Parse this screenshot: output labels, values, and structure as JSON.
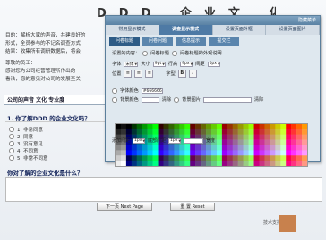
{
  "survey": {
    "title": "DDD 企业文 化 调查",
    "intro": [
      "目的：解析大家的声音，共建良好的",
      "形式，全员参与的不记名调查方式",
      "结果：收集所有调研数据后，将会"
    ],
    "greeting": [
      "尊敬的员工：",
      "感谢您为公司经营管理所作出的",
      "看法，您的意见对公司的发展至关"
    ],
    "section": "公司的声音 文化 专业度",
    "q1": "1. 你了解DDD 的企业文化吗？",
    "options": [
      "1. 非常同意",
      "2. 同意",
      "3. 没有意见",
      "4. 不同意",
      "5. 非常不同意"
    ],
    "q2": "你对了解的企业文化是什么？",
    "next_button": "下一页 Next Page",
    "reset_button": "重 置 Reset",
    "logo_text": "技术支持"
  },
  "panel": {
    "hide_menu": "隐藏菜单",
    "top_tabs": [
      "常用显示模式",
      "调查显示模式",
      "设置页面外框",
      "设置页面图片"
    ],
    "top_tab_active": 1,
    "sub_tabs": [
      "问卷标题",
      "问卷问题",
      "信息提示",
      "提交栏"
    ],
    "sub_tab_active": 0,
    "target_label": "设置的内容：",
    "target_options": [
      "问卷标题",
      "问卷标题的外观说明"
    ],
    "font_label": "字体",
    "font_value": "宋体",
    "size_label": "大小",
    "size_value": "9pt",
    "line_label": "行高",
    "line_value": "9px",
    "spacing_label": "间距",
    "spacing_value": "0px",
    "pos_label": "位置",
    "align_icons": [
      "≡",
      "≡",
      "≡"
    ],
    "style_label": "字型",
    "style_icons": [
      "B",
      "I"
    ],
    "font_color_label": "字体颜色",
    "font_color_value": "#666666",
    "bg_color_label": "背景颜色",
    "bg_color_btn": "清除",
    "bg_image_label": "背景图片",
    "bg_image_btn": "清除",
    "pad_label": "添加间距",
    "pad_value": "1px",
    "border_label": "底部间距",
    "border_value": "1px",
    "width_label": "宽度"
  },
  "colors": {
    "accent": "#4e7aa5",
    "panel_bg": "#dfe8ef",
    "logo": "#c8814d"
  }
}
